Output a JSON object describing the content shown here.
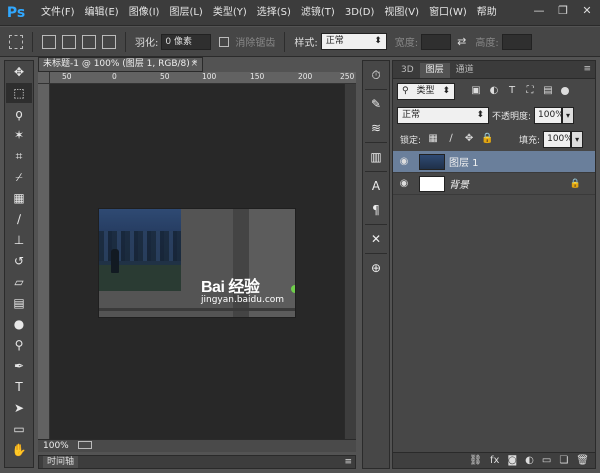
{
  "app": {
    "logo": "Ps"
  },
  "menu": [
    "文件(F)",
    "编辑(E)",
    "图像(I)",
    "图层(L)",
    "类型(Y)",
    "选择(S)",
    "滤镜(T)",
    "3D(D)",
    "视图(V)",
    "窗口(W)",
    "帮助"
  ],
  "window_controls": {
    "minimize": "—",
    "restore": "❐",
    "close": "✕"
  },
  "options_bar": {
    "feather_label": "羽化:",
    "feather_value": "0 像素",
    "antialias_label": "消除锯齿",
    "style_label": "样式:",
    "style_value": "正常",
    "width_label": "宽度:",
    "height_label": "高度:"
  },
  "document": {
    "tab_title": "未标题-1 @ 100% (图层 1, RGB/8) *",
    "tab_close": "×",
    "ruler_ticks": [
      "50",
      "0",
      "50",
      "100",
      "150",
      "200",
      "250"
    ],
    "zoom": "100%",
    "watermark_text": "Bai  经验",
    "watermark_url": "jingyan.baidu.com"
  },
  "timeline": {
    "label": "时间轴",
    "menu": "≡"
  },
  "panel": {
    "tabs": [
      "3D",
      "图层",
      "通道"
    ],
    "active_tab": "图层",
    "menu_icon": "≡",
    "filter_kind": "类型",
    "blend_mode": "正常",
    "opacity_label": "不透明度:",
    "opacity_value": "100%",
    "lock_label": "锁定:",
    "fill_label": "填充:",
    "fill_value": "100%",
    "layers": [
      {
        "name": "图层 1",
        "selected": true
      },
      {
        "name": "背景",
        "locked": true
      }
    ],
    "bottom_icons": [
      "link-icon",
      "fx-icon",
      "mask-icon",
      "adjustment-icon",
      "group-icon",
      "new-layer-icon",
      "trash-icon"
    ]
  },
  "colors": {
    "accent": "#31a8ff",
    "selected_layer": "#6a7f9b",
    "canvas_bg": "#282828"
  }
}
